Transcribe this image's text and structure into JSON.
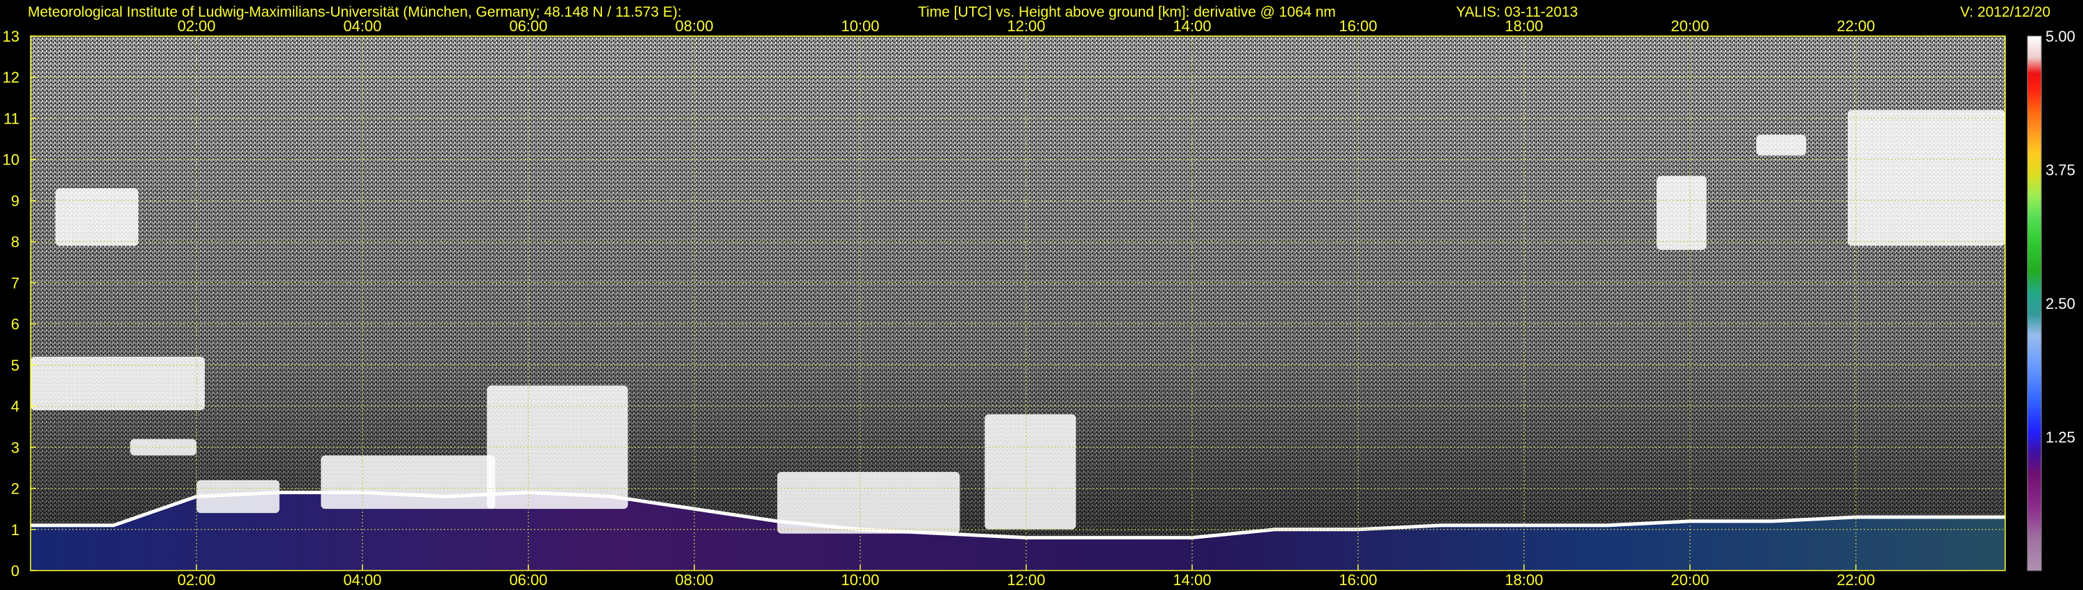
{
  "header": {
    "institute": "Meteorological Institute of Ludwig-Maximilians-Universität (München, Germany; 48.148 N / 11.573 E):",
    "title": "Time [UTC] vs. Height above ground [km]: derivative @ 1064 nm",
    "instrument_date": "YALIS: 03-11-2013",
    "version": "V: 2012/12/20"
  },
  "colors": {
    "background": "#000000",
    "text": "#ffff33",
    "grid": "#c8c84a",
    "noise_light": "#d8d8d8",
    "noise_dark": "#5a5a5a",
    "aerosol": "#7733ee",
    "aerosol_alt": "#3366ff",
    "cloud": "#ffffff"
  },
  "chart_data": {
    "type": "heatmap",
    "title": "Time [UTC] vs. Height above ground [km]: derivative @ 1064 nm",
    "x": {
      "unit": "UTC hour",
      "range": [
        0,
        23.8
      ],
      "ticks": [
        2,
        4,
        6,
        8,
        10,
        12,
        14,
        16,
        18,
        20,
        22
      ],
      "tick_labels": [
        "02:00",
        "04:00",
        "06:00",
        "08:00",
        "10:00",
        "12:00",
        "14:00",
        "16:00",
        "18:00",
        "20:00",
        "22:00"
      ]
    },
    "y": {
      "unit": "km",
      "range": [
        0,
        13
      ],
      "ticks": [
        0,
        1,
        2,
        3,
        4,
        5,
        6,
        7,
        8,
        9,
        10,
        11,
        12,
        13
      ],
      "tick_labels": [
        "0",
        "1",
        "2",
        "3",
        "4",
        "5",
        "6",
        "7",
        "8",
        "9",
        "10",
        "11",
        "12",
        "13"
      ]
    },
    "grid": true,
    "colorbar": {
      "range": [
        0,
        5
      ],
      "tick_labels": [
        "1.25",
        "2.50",
        "3.75",
        "5.00"
      ],
      "tick_values": [
        1.25,
        2.5,
        3.75,
        5.0
      ],
      "stops": [
        {
          "v": 0.0,
          "c": "#b090b0"
        },
        {
          "v": 0.3,
          "c": "#a070a0"
        },
        {
          "v": 0.6,
          "c": "#8a2a8a"
        },
        {
          "v": 0.9,
          "c": "#701070"
        },
        {
          "v": 1.1,
          "c": "#4010a0"
        },
        {
          "v": 1.3,
          "c": "#2020ff"
        },
        {
          "v": 1.6,
          "c": "#3366ff"
        },
        {
          "v": 1.9,
          "c": "#6699ff"
        },
        {
          "v": 2.2,
          "c": "#99bbee"
        },
        {
          "v": 2.4,
          "c": "#339999"
        },
        {
          "v": 2.6,
          "c": "#22aa88"
        },
        {
          "v": 2.8,
          "c": "#22aa22"
        },
        {
          "v": 3.1,
          "c": "#33cc33"
        },
        {
          "v": 3.3,
          "c": "#55dd55"
        },
        {
          "v": 3.5,
          "c": "#99ee55"
        },
        {
          "v": 3.7,
          "c": "#dddd22"
        },
        {
          "v": 3.9,
          "c": "#ffcc22"
        },
        {
          "v": 4.1,
          "c": "#ff9922"
        },
        {
          "v": 4.3,
          "c": "#ff6611"
        },
        {
          "v": 4.5,
          "c": "#ff2211"
        },
        {
          "v": 4.65,
          "c": "#ee1111"
        },
        {
          "v": 4.8,
          "c": "#eecccc"
        },
        {
          "v": 5.0,
          "c": "#ffffff"
        }
      ]
    },
    "boundary_layer_top_km": [
      [
        0,
        1.1
      ],
      [
        1,
        1.1
      ],
      [
        2,
        1.8
      ],
      [
        3,
        1.9
      ],
      [
        4,
        1.9
      ],
      [
        5,
        1.8
      ],
      [
        6,
        1.9
      ],
      [
        7,
        1.8
      ],
      [
        8,
        1.5
      ],
      [
        9,
        1.2
      ],
      [
        10,
        1.0
      ],
      [
        11,
        0.9
      ],
      [
        12,
        0.8
      ],
      [
        13,
        0.8
      ],
      [
        14,
        0.8
      ],
      [
        15,
        1.0
      ],
      [
        16,
        1.0
      ],
      [
        17,
        1.1
      ],
      [
        18,
        1.1
      ],
      [
        19,
        1.1
      ],
      [
        20,
        1.2
      ],
      [
        21,
        1.2
      ],
      [
        22,
        1.3
      ],
      [
        23,
        1.3
      ],
      [
        23.8,
        1.3
      ]
    ],
    "clouds": [
      {
        "t0": 0.0,
        "t1": 2.1,
        "h0": 3.9,
        "h1": 5.2
      },
      {
        "t0": 0.3,
        "t1": 1.3,
        "h0": 7.9,
        "h1": 9.3
      },
      {
        "t0": 1.2,
        "t1": 2.0,
        "h0": 2.8,
        "h1": 3.2
      },
      {
        "t0": 2.0,
        "t1": 3.0,
        "h0": 1.4,
        "h1": 2.2
      },
      {
        "t0": 3.5,
        "t1": 5.6,
        "h0": 1.5,
        "h1": 2.8
      },
      {
        "t0": 5.5,
        "t1": 7.2,
        "h0": 1.5,
        "h1": 4.5
      },
      {
        "t0": 9.0,
        "t1": 11.2,
        "h0": 0.9,
        "h1": 2.4
      },
      {
        "t0": 11.5,
        "t1": 12.6,
        "h0": 1.0,
        "h1": 3.8
      },
      {
        "t0": 19.6,
        "t1": 20.2,
        "h0": 7.8,
        "h1": 9.6
      },
      {
        "t0": 20.8,
        "t1": 21.4,
        "h0": 10.1,
        "h1": 10.6
      },
      {
        "t0": 21.9,
        "t1": 23.8,
        "h0": 7.9,
        "h1": 11.2
      }
    ]
  }
}
